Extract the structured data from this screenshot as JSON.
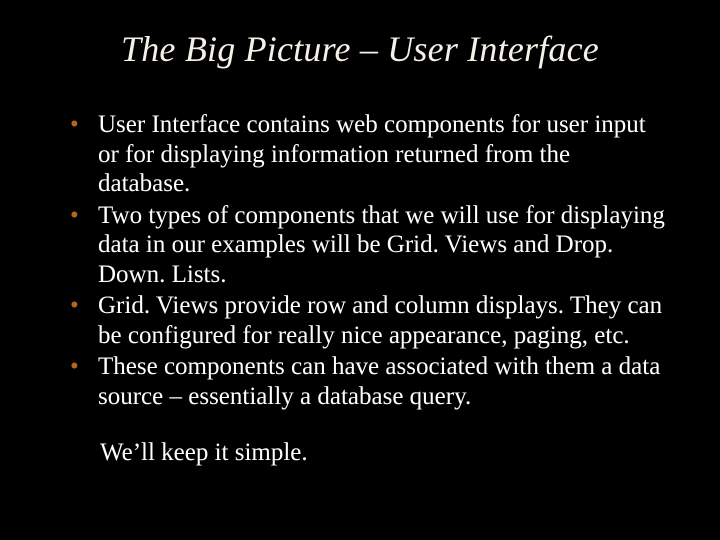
{
  "title": "The Big Picture – User Interface",
  "bullets": [
    "User Interface contains web components for user input or for displaying information returned from the database.",
    "Two types of components that we will use for displaying data in our examples will be Grid. Views and Drop. Down. Lists.",
    "Grid. Views provide row and column displays. They can be configured for really nice appearance, paging, etc.",
    "These components can have associated with them a data source – essentially a database query."
  ],
  "footer": "We’ll keep it simple."
}
